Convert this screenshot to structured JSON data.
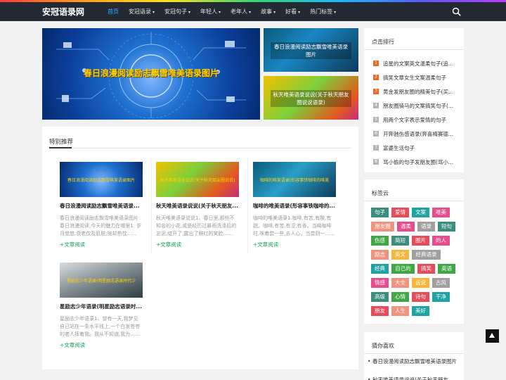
{
  "site": {
    "logo": "安冠语录网"
  },
  "nav": [
    {
      "label": "首页",
      "active": true,
      "caret": false
    },
    {
      "label": "安冠语录",
      "active": false,
      "caret": true
    },
    {
      "label": "安冠句子",
      "active": false,
      "caret": true
    },
    {
      "label": "年轻人",
      "active": false,
      "caret": true
    },
    {
      "label": "老年人",
      "active": false,
      "caret": true
    },
    {
      "label": "故事",
      "active": false,
      "caret": true
    },
    {
      "label": "好看",
      "active": false,
      "caret": true
    },
    {
      "label": "热门标签",
      "active": false,
      "caret": true
    }
  ],
  "banner": {
    "main_title": "春日浪漫阅读励志飘雪唯美语录图片",
    "side_top": "春日浪漫阅读励志飘雪唯美语录图片",
    "side_bottom": "秋天唯美语录说说(关于秋天朋友圈说说语录)"
  },
  "recommend": {
    "title": "特别推荐",
    "more_label": "+文章阅读",
    "cards": [
      {
        "thumb_text": "春日浪漫阅读励志飘雪唯美语录图片",
        "title": "春日浪漫阅读励志飘雪唯美语录...",
        "excerpt": "春日浪漫阅读励志飘雪唯美语录图片 春日浪漫阅读,今天的魅力在哪里1. 岁月悠悠,衰老仅及肌肤;抛却热忱......"
      },
      {
        "thumb_text": "秋天唯美语录说说(关于秋天朋友圈说说)",
        "title": "秋天唯美语录说说(关于秋天朋友...",
        "excerpt": "秋天唯美语录说说1、春日里,那些不知名的小花,或是经历过暴雨洗涤后的淤泥,绽开了,露出了鲜红的笑脸......"
      },
      {
        "thumb_text": "咖啡的唯美语录(形容事铁咖啡的唯美",
        "title": "咖啡的唯美语录(形容事铁咖啡的...",
        "excerpt": "咖啡的唯美语录1.咖啡,有苦,有酸,有甜。咖啡,有苦,有涩,有香。当喝咖啡时,咪着尝一些,去人心。当尝到一......"
      },
      {
        "thumb_text": "星励志少年语录(明星励志语录时代少",
        "title": "星励志少年语录(明星励志语录时...",
        "excerpt": "星励志少年语录1、曾有一天,我梦见自己站在一条水平线上,一个白发苍苍的老人摔着我。我从不知道,我为......"
      }
    ]
  },
  "ranking": {
    "title": "点击排行",
    "items": [
      {
        "no": "1",
        "text": "追星的文案英文温柔句子(追..."
      },
      {
        "no": "2",
        "text": "搞笑文章女生文案温柔句子"
      },
      {
        "no": "3",
        "text": "黄金发朋友圈的精美句子(买..."
      },
      {
        "no": "4",
        "text": "朋友圈骑马的文案搞笑句子(..."
      },
      {
        "no": "5",
        "text": "用两个文字表示爱情的句子"
      },
      {
        "no": "6",
        "text": "开奔驰伤感语录(奔喜梅赛德..."
      },
      {
        "no": "7",
        "text": "富婆生活句子"
      },
      {
        "no": "8",
        "text": "骂小偷的句子发朋友圈(骂小..."
      }
    ]
  },
  "tagcloud": {
    "title": "标签云",
    "tags": [
      {
        "label": "句子",
        "color": "#3b8e7e"
      },
      {
        "label": "爱情",
        "color": "#e84c5b"
      },
      {
        "label": "文案",
        "color": "#20a3a3"
      },
      {
        "label": "唯美",
        "color": "#e84c8b"
      },
      {
        "label": "朋友圈",
        "color": "#f0947f"
      },
      {
        "label": "温柔",
        "color": "#e84c8b"
      },
      {
        "label": "语录",
        "color": "#a0a0a0"
      },
      {
        "label": "短句",
        "color": "#3b8e7e"
      },
      {
        "label": "伤感",
        "color": "#3fa845"
      },
      {
        "label": "简短",
        "color": "#3b8e7e"
      },
      {
        "label": "图片",
        "color": "#e84c5b"
      },
      {
        "label": "的人",
        "color": "#e84c8b"
      },
      {
        "label": "励志",
        "color": "#f0947f"
      },
      {
        "label": "英文",
        "color": "#f5b63a"
      },
      {
        "label": "经典语录",
        "color": "#a0a0a0"
      },
      {
        "label": "经典",
        "color": "#20a3a3"
      },
      {
        "label": "自己的",
        "color": "#3fa845"
      },
      {
        "label": "搞笑",
        "color": "#e84c5b"
      },
      {
        "label": "英语",
        "color": "#3fa845"
      },
      {
        "label": "情感",
        "color": "#e84c8b"
      },
      {
        "label": "大全",
        "color": "#f0947f"
      },
      {
        "label": "说说",
        "color": "#f5b63a"
      },
      {
        "label": "古风",
        "color": "#a0a0a0"
      },
      {
        "label": "高级",
        "color": "#3b8e7e"
      },
      {
        "label": "心情",
        "color": "#3fa845"
      },
      {
        "label": "诗句",
        "color": "#e84c5b"
      },
      {
        "label": "干净",
        "color": "#20a3a3"
      },
      {
        "label": "朋友",
        "color": "#e84c5b"
      },
      {
        "label": "人生",
        "color": "#f0947f"
      },
      {
        "label": "美好",
        "color": "#20a3a3"
      }
    ]
  },
  "guess": {
    "title": "猜你喜欢",
    "items": [
      {
        "text": "春日浪漫阅读励志飘雪唯美语录图片"
      },
      {
        "text": "秋天唯美语录说说(关于秋天朋友"
      }
    ]
  }
}
